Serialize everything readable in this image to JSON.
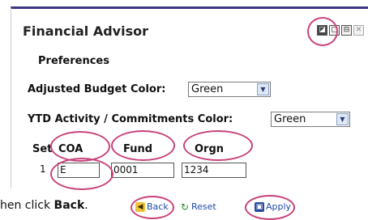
{
  "panel": {
    "title": "Financial Advisor",
    "section": "Preferences"
  },
  "window_controls": [
    {
      "name": "edit-icon",
      "glyph": "◪"
    },
    {
      "name": "restore-icon",
      "glyph": "▢"
    },
    {
      "name": "pin-icon",
      "glyph": "⊟"
    },
    {
      "name": "close-icon",
      "glyph": "✕"
    }
  ],
  "budget_color": {
    "label": "Adjusted Budget Color:",
    "value": "Green"
  },
  "ytd_color": {
    "label": "YTD Activity / Commitments Color:",
    "value": "Green"
  },
  "table": {
    "headers": {
      "set": "Set",
      "coa": "COA",
      "fund": "Fund",
      "orgn": "Orgn"
    },
    "row": {
      "set": "1",
      "coa": "E",
      "fund": "0001",
      "orgn": "1234"
    }
  },
  "instruction": {
    "prefix": "hen click ",
    "bold": "Back",
    "suffix": "."
  },
  "buttons": {
    "back": "Back",
    "reset": "Reset",
    "apply": "Apply"
  },
  "colors": {
    "accent_bar": "#3c3680",
    "highlight_ring": "#c8427a",
    "link_blue": "#1f4aa8"
  }
}
